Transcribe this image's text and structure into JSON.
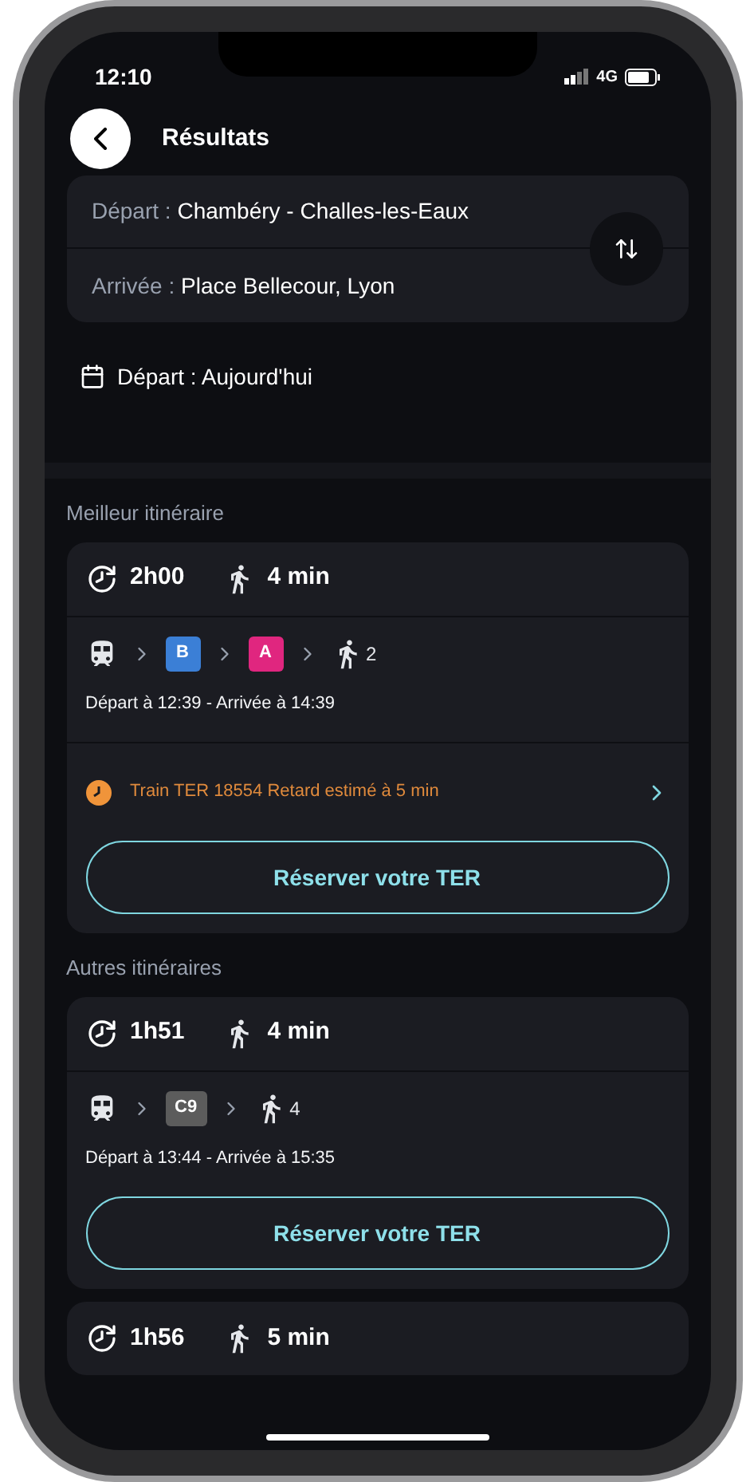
{
  "status_bar": {
    "time": "12:10",
    "network": "4G"
  },
  "header": {
    "title": "Résultats"
  },
  "route": {
    "from_label": "Départ :",
    "from": "Chambéry - Challes-les-Eaux",
    "to_label": "Arrivée :",
    "to": "Place Bellecour, Lyon"
  },
  "date": {
    "label": "Départ : Aujourd'hui"
  },
  "best": {
    "heading": "Meilleur itinéraire",
    "itineraries": [
      {
        "duration": "2h00",
        "walk": "4 min",
        "segments": [
          {
            "kind": "train"
          },
          {
            "kind": "line",
            "label": "B",
            "color": "#3b7fd6"
          },
          {
            "kind": "line",
            "label": "A",
            "color": "#e0267f"
          },
          {
            "kind": "walk",
            "count": "2"
          }
        ],
        "times": "Départ à 12:39 - Arrivée à 14:39",
        "alert": "Train TER 18554 Retard estimé à 5 min",
        "button": "Réserver votre TER"
      }
    ]
  },
  "others": {
    "heading": "Autres itinéraires",
    "itineraries": [
      {
        "duration": "1h51",
        "walk": "4 min",
        "segments": [
          {
            "kind": "train"
          },
          {
            "kind": "line",
            "label": "C9",
            "color": "#5c5c5c"
          },
          {
            "kind": "walk",
            "count": "4"
          }
        ],
        "times": "Départ à 13:44 - Arrivée à 15:35",
        "button": "Réserver votre TER"
      },
      {
        "duration": "1h56",
        "walk": "5 min"
      }
    ]
  }
}
